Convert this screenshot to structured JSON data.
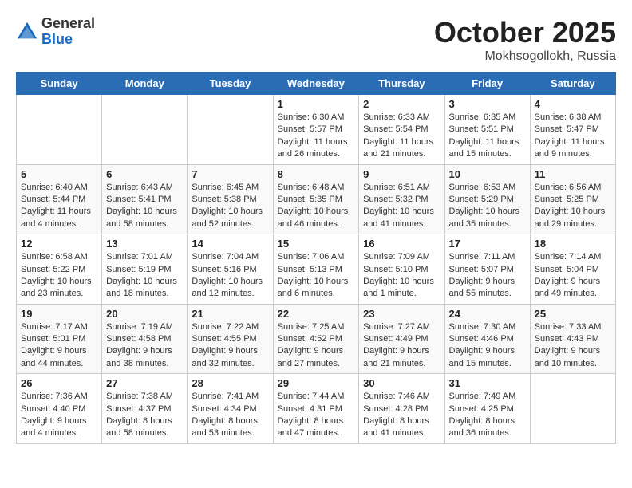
{
  "header": {
    "logo_general": "General",
    "logo_blue": "Blue",
    "month": "October 2025",
    "location": "Mokhsogollokh, Russia"
  },
  "weekdays": [
    "Sunday",
    "Monday",
    "Tuesday",
    "Wednesday",
    "Thursday",
    "Friday",
    "Saturday"
  ],
  "weeks": [
    [
      {
        "day": "",
        "info": ""
      },
      {
        "day": "",
        "info": ""
      },
      {
        "day": "",
        "info": ""
      },
      {
        "day": "1",
        "info": "Sunrise: 6:30 AM\nSunset: 5:57 PM\nDaylight: 11 hours and 26 minutes."
      },
      {
        "day": "2",
        "info": "Sunrise: 6:33 AM\nSunset: 5:54 PM\nDaylight: 11 hours and 21 minutes."
      },
      {
        "day": "3",
        "info": "Sunrise: 6:35 AM\nSunset: 5:51 PM\nDaylight: 11 hours and 15 minutes."
      },
      {
        "day": "4",
        "info": "Sunrise: 6:38 AM\nSunset: 5:47 PM\nDaylight: 11 hours and 9 minutes."
      }
    ],
    [
      {
        "day": "5",
        "info": "Sunrise: 6:40 AM\nSunset: 5:44 PM\nDaylight: 11 hours and 4 minutes."
      },
      {
        "day": "6",
        "info": "Sunrise: 6:43 AM\nSunset: 5:41 PM\nDaylight: 10 hours and 58 minutes."
      },
      {
        "day": "7",
        "info": "Sunrise: 6:45 AM\nSunset: 5:38 PM\nDaylight: 10 hours and 52 minutes."
      },
      {
        "day": "8",
        "info": "Sunrise: 6:48 AM\nSunset: 5:35 PM\nDaylight: 10 hours and 46 minutes."
      },
      {
        "day": "9",
        "info": "Sunrise: 6:51 AM\nSunset: 5:32 PM\nDaylight: 10 hours and 41 minutes."
      },
      {
        "day": "10",
        "info": "Sunrise: 6:53 AM\nSunset: 5:29 PM\nDaylight: 10 hours and 35 minutes."
      },
      {
        "day": "11",
        "info": "Sunrise: 6:56 AM\nSunset: 5:25 PM\nDaylight: 10 hours and 29 minutes."
      }
    ],
    [
      {
        "day": "12",
        "info": "Sunrise: 6:58 AM\nSunset: 5:22 PM\nDaylight: 10 hours and 23 minutes."
      },
      {
        "day": "13",
        "info": "Sunrise: 7:01 AM\nSunset: 5:19 PM\nDaylight: 10 hours and 18 minutes."
      },
      {
        "day": "14",
        "info": "Sunrise: 7:04 AM\nSunset: 5:16 PM\nDaylight: 10 hours and 12 minutes."
      },
      {
        "day": "15",
        "info": "Sunrise: 7:06 AM\nSunset: 5:13 PM\nDaylight: 10 hours and 6 minutes."
      },
      {
        "day": "16",
        "info": "Sunrise: 7:09 AM\nSunset: 5:10 PM\nDaylight: 10 hours and 1 minute."
      },
      {
        "day": "17",
        "info": "Sunrise: 7:11 AM\nSunset: 5:07 PM\nDaylight: 9 hours and 55 minutes."
      },
      {
        "day": "18",
        "info": "Sunrise: 7:14 AM\nSunset: 5:04 PM\nDaylight: 9 hours and 49 minutes."
      }
    ],
    [
      {
        "day": "19",
        "info": "Sunrise: 7:17 AM\nSunset: 5:01 PM\nDaylight: 9 hours and 44 minutes."
      },
      {
        "day": "20",
        "info": "Sunrise: 7:19 AM\nSunset: 4:58 PM\nDaylight: 9 hours and 38 minutes."
      },
      {
        "day": "21",
        "info": "Sunrise: 7:22 AM\nSunset: 4:55 PM\nDaylight: 9 hours and 32 minutes."
      },
      {
        "day": "22",
        "info": "Sunrise: 7:25 AM\nSunset: 4:52 PM\nDaylight: 9 hours and 27 minutes."
      },
      {
        "day": "23",
        "info": "Sunrise: 7:27 AM\nSunset: 4:49 PM\nDaylight: 9 hours and 21 minutes."
      },
      {
        "day": "24",
        "info": "Sunrise: 7:30 AM\nSunset: 4:46 PM\nDaylight: 9 hours and 15 minutes."
      },
      {
        "day": "25",
        "info": "Sunrise: 7:33 AM\nSunset: 4:43 PM\nDaylight: 9 hours and 10 minutes."
      }
    ],
    [
      {
        "day": "26",
        "info": "Sunrise: 7:36 AM\nSunset: 4:40 PM\nDaylight: 9 hours and 4 minutes."
      },
      {
        "day": "27",
        "info": "Sunrise: 7:38 AM\nSunset: 4:37 PM\nDaylight: 8 hours and 58 minutes."
      },
      {
        "day": "28",
        "info": "Sunrise: 7:41 AM\nSunset: 4:34 PM\nDaylight: 8 hours and 53 minutes."
      },
      {
        "day": "29",
        "info": "Sunrise: 7:44 AM\nSunset: 4:31 PM\nDaylight: 8 hours and 47 minutes."
      },
      {
        "day": "30",
        "info": "Sunrise: 7:46 AM\nSunset: 4:28 PM\nDaylight: 8 hours and 41 minutes."
      },
      {
        "day": "31",
        "info": "Sunrise: 7:49 AM\nSunset: 4:25 PM\nDaylight: 8 hours and 36 minutes."
      },
      {
        "day": "",
        "info": ""
      }
    ]
  ]
}
